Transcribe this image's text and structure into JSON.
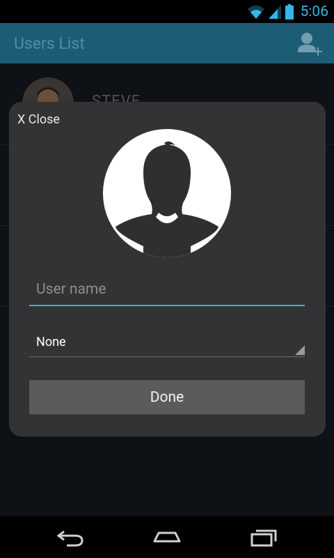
{
  "status_bar": {
    "time": "5:06",
    "icons": [
      "wifi-icon",
      "signal-icon",
      "battery-icon"
    ]
  },
  "action_bar": {
    "title": "Users List",
    "action_icon": "add-user-icon"
  },
  "list": {
    "items": [
      {
        "name": "STEVE"
      }
    ]
  },
  "dialog": {
    "close_label": "X Close",
    "username_placeholder": "User name",
    "username_value": "",
    "spinner_value": "None",
    "done_label": "Done"
  },
  "nav_bar": {
    "buttons": [
      "back-icon",
      "home-icon",
      "recent-apps-icon"
    ]
  },
  "colors": {
    "accent": "#33b5e5",
    "action_bar": "#1c5d75",
    "dialog_bg": "#333335",
    "button_bg": "#5b5b5b"
  }
}
